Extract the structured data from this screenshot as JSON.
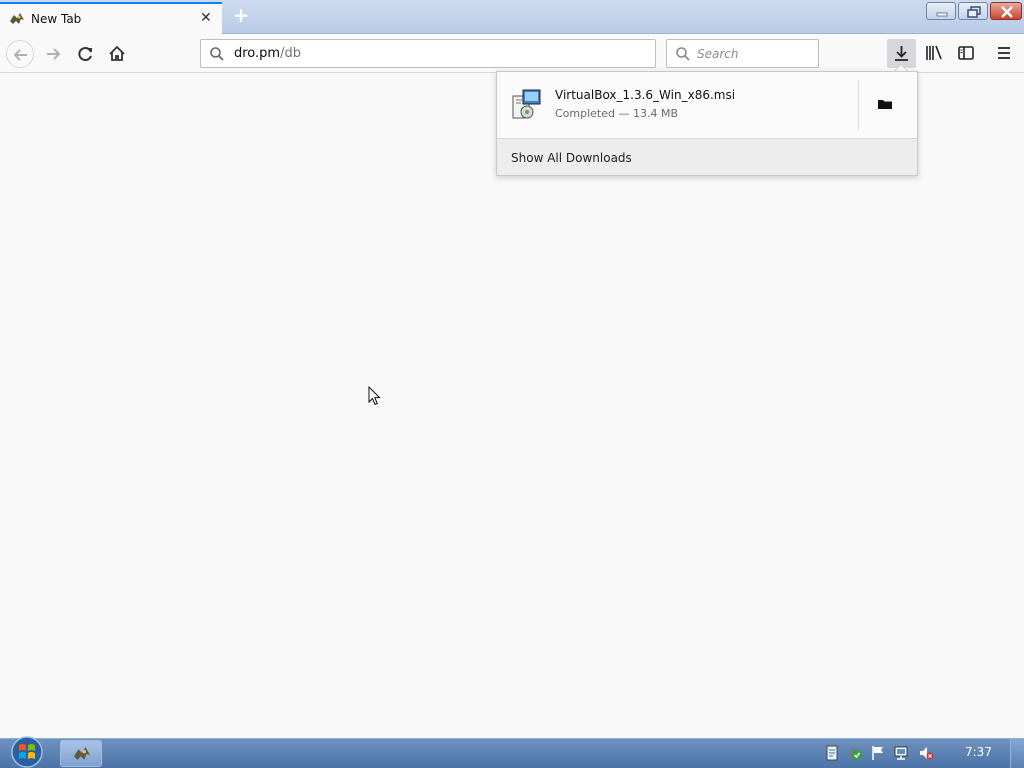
{
  "tab": {
    "title": "New Tab",
    "close": "✕"
  },
  "newtab": {
    "label": "+"
  },
  "urlbar": {
    "host": "dro.pm",
    "path": "/db"
  },
  "searchbar": {
    "placeholder": "Search"
  },
  "downloads_panel": {
    "item": {
      "filename": "VirtualBox_1.3.6_Win_x86.msi",
      "status": "Completed — 13.4 MB"
    },
    "footer": {
      "show_all": "Show All Downloads"
    }
  },
  "taskbar": {
    "clock": "7:37"
  },
  "colors": {
    "tab_accent": "#0a84ff",
    "taskbar": "#4c73a8",
    "close_button": "#c7452d"
  },
  "icons": [
    "firefox-icon",
    "back-icon",
    "forward-icon",
    "reload-icon",
    "home-icon",
    "search-icon",
    "download-icon",
    "library-icon",
    "sidebar-icon",
    "menu-icon",
    "msi-installer-icon",
    "folder-icon",
    "windows-logo-icon"
  ]
}
